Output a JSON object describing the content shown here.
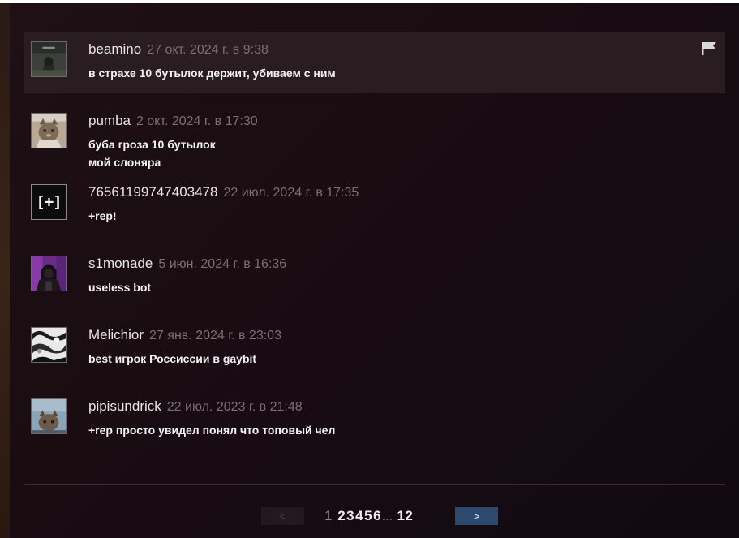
{
  "colors": {
    "panel_bg": "#1a0d13",
    "highlight_bg": "#2a1d22",
    "author": "#e6e6e6",
    "timestamp": "#7a6f73",
    "text": "#f2f2f2",
    "next_button": "#2d4a6e"
  },
  "comments": [
    {
      "author": "beamino",
      "timestamp": "27 окт. 2024 г. в 9:38",
      "lines": [
        "в страхе 10 бутылок держит, убиваем с ним"
      ],
      "avatar": "dark-figure-avatar",
      "highlighted": true,
      "flag_icon": "flag-icon"
    },
    {
      "author": "pumba",
      "timestamp": "2 окт. 2024 г. в 17:30",
      "lines": [
        "буба гроза 10 бутылок",
        "мой слоняра"
      ],
      "avatar": "cat-avatar"
    },
    {
      "author": "76561199747403478",
      "timestamp": "22 июл. 2024 г. в 17:35",
      "lines": [
        "+rep!"
      ],
      "avatar": "plus-bracket-avatar",
      "avatar_text": "[+]"
    },
    {
      "author": "s1monade",
      "timestamp": "5 июн. 2024 г. в 16:36",
      "lines": [
        "useless bot"
      ],
      "avatar": "hooded-figure-avatar"
    },
    {
      "author": "Melichior",
      "timestamp": "27 янв. 2024 г. в 23:03",
      "lines": [
        "best игрок Россиссии в gaybit"
      ],
      "avatar": "abstract-bw-avatar"
    },
    {
      "author": "pipisundrick",
      "timestamp": "22 июл. 2023 г. в 21:48",
      "lines": [
        "+rep просто увидел понял что топовый чел"
      ],
      "avatar": "cat-photo-avatar"
    }
  ],
  "pagination": {
    "prev_label": "<",
    "next_label": ">",
    "current_page": "1",
    "pages": [
      "2",
      "3",
      "4",
      "5",
      "6"
    ],
    "ellipsis": "...",
    "last_page": "12"
  }
}
